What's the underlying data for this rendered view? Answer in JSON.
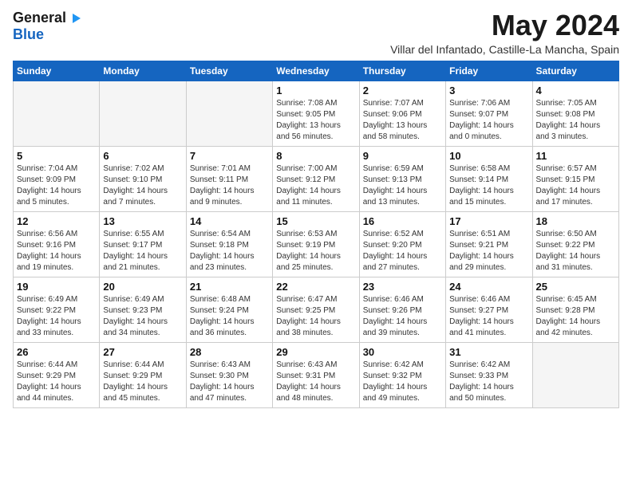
{
  "logo": {
    "general": "General",
    "blue": "Blue",
    "arrow": "▶"
  },
  "header": {
    "month_title": "May 2024",
    "subtitle": "Villar del Infantado, Castille-La Mancha, Spain"
  },
  "calendar": {
    "weekdays": [
      "Sunday",
      "Monday",
      "Tuesday",
      "Wednesday",
      "Thursday",
      "Friday",
      "Saturday"
    ],
    "weeks": [
      [
        {
          "day": "",
          "info": ""
        },
        {
          "day": "",
          "info": ""
        },
        {
          "day": "",
          "info": ""
        },
        {
          "day": "1",
          "info": "Sunrise: 7:08 AM\nSunset: 9:05 PM\nDaylight: 13 hours\nand 56 minutes."
        },
        {
          "day": "2",
          "info": "Sunrise: 7:07 AM\nSunset: 9:06 PM\nDaylight: 13 hours\nand 58 minutes."
        },
        {
          "day": "3",
          "info": "Sunrise: 7:06 AM\nSunset: 9:07 PM\nDaylight: 14 hours\nand 0 minutes."
        },
        {
          "day": "4",
          "info": "Sunrise: 7:05 AM\nSunset: 9:08 PM\nDaylight: 14 hours\nand 3 minutes."
        }
      ],
      [
        {
          "day": "5",
          "info": "Sunrise: 7:04 AM\nSunset: 9:09 PM\nDaylight: 14 hours\nand 5 minutes."
        },
        {
          "day": "6",
          "info": "Sunrise: 7:02 AM\nSunset: 9:10 PM\nDaylight: 14 hours\nand 7 minutes."
        },
        {
          "day": "7",
          "info": "Sunrise: 7:01 AM\nSunset: 9:11 PM\nDaylight: 14 hours\nand 9 minutes."
        },
        {
          "day": "8",
          "info": "Sunrise: 7:00 AM\nSunset: 9:12 PM\nDaylight: 14 hours\nand 11 minutes."
        },
        {
          "day": "9",
          "info": "Sunrise: 6:59 AM\nSunset: 9:13 PM\nDaylight: 14 hours\nand 13 minutes."
        },
        {
          "day": "10",
          "info": "Sunrise: 6:58 AM\nSunset: 9:14 PM\nDaylight: 14 hours\nand 15 minutes."
        },
        {
          "day": "11",
          "info": "Sunrise: 6:57 AM\nSunset: 9:15 PM\nDaylight: 14 hours\nand 17 minutes."
        }
      ],
      [
        {
          "day": "12",
          "info": "Sunrise: 6:56 AM\nSunset: 9:16 PM\nDaylight: 14 hours\nand 19 minutes."
        },
        {
          "day": "13",
          "info": "Sunrise: 6:55 AM\nSunset: 9:17 PM\nDaylight: 14 hours\nand 21 minutes."
        },
        {
          "day": "14",
          "info": "Sunrise: 6:54 AM\nSunset: 9:18 PM\nDaylight: 14 hours\nand 23 minutes."
        },
        {
          "day": "15",
          "info": "Sunrise: 6:53 AM\nSunset: 9:19 PM\nDaylight: 14 hours\nand 25 minutes."
        },
        {
          "day": "16",
          "info": "Sunrise: 6:52 AM\nSunset: 9:20 PM\nDaylight: 14 hours\nand 27 minutes."
        },
        {
          "day": "17",
          "info": "Sunrise: 6:51 AM\nSunset: 9:21 PM\nDaylight: 14 hours\nand 29 minutes."
        },
        {
          "day": "18",
          "info": "Sunrise: 6:50 AM\nSunset: 9:22 PM\nDaylight: 14 hours\nand 31 minutes."
        }
      ],
      [
        {
          "day": "19",
          "info": "Sunrise: 6:49 AM\nSunset: 9:22 PM\nDaylight: 14 hours\nand 33 minutes."
        },
        {
          "day": "20",
          "info": "Sunrise: 6:49 AM\nSunset: 9:23 PM\nDaylight: 14 hours\nand 34 minutes."
        },
        {
          "day": "21",
          "info": "Sunrise: 6:48 AM\nSunset: 9:24 PM\nDaylight: 14 hours\nand 36 minutes."
        },
        {
          "day": "22",
          "info": "Sunrise: 6:47 AM\nSunset: 9:25 PM\nDaylight: 14 hours\nand 38 minutes."
        },
        {
          "day": "23",
          "info": "Sunrise: 6:46 AM\nSunset: 9:26 PM\nDaylight: 14 hours\nand 39 minutes."
        },
        {
          "day": "24",
          "info": "Sunrise: 6:46 AM\nSunset: 9:27 PM\nDaylight: 14 hours\nand 41 minutes."
        },
        {
          "day": "25",
          "info": "Sunrise: 6:45 AM\nSunset: 9:28 PM\nDaylight: 14 hours\nand 42 minutes."
        }
      ],
      [
        {
          "day": "26",
          "info": "Sunrise: 6:44 AM\nSunset: 9:29 PM\nDaylight: 14 hours\nand 44 minutes."
        },
        {
          "day": "27",
          "info": "Sunrise: 6:44 AM\nSunset: 9:29 PM\nDaylight: 14 hours\nand 45 minutes."
        },
        {
          "day": "28",
          "info": "Sunrise: 6:43 AM\nSunset: 9:30 PM\nDaylight: 14 hours\nand 47 minutes."
        },
        {
          "day": "29",
          "info": "Sunrise: 6:43 AM\nSunset: 9:31 PM\nDaylight: 14 hours\nand 48 minutes."
        },
        {
          "day": "30",
          "info": "Sunrise: 6:42 AM\nSunset: 9:32 PM\nDaylight: 14 hours\nand 49 minutes."
        },
        {
          "day": "31",
          "info": "Sunrise: 6:42 AM\nSunset: 9:33 PM\nDaylight: 14 hours\nand 50 minutes."
        },
        {
          "day": "",
          "info": ""
        }
      ]
    ]
  }
}
